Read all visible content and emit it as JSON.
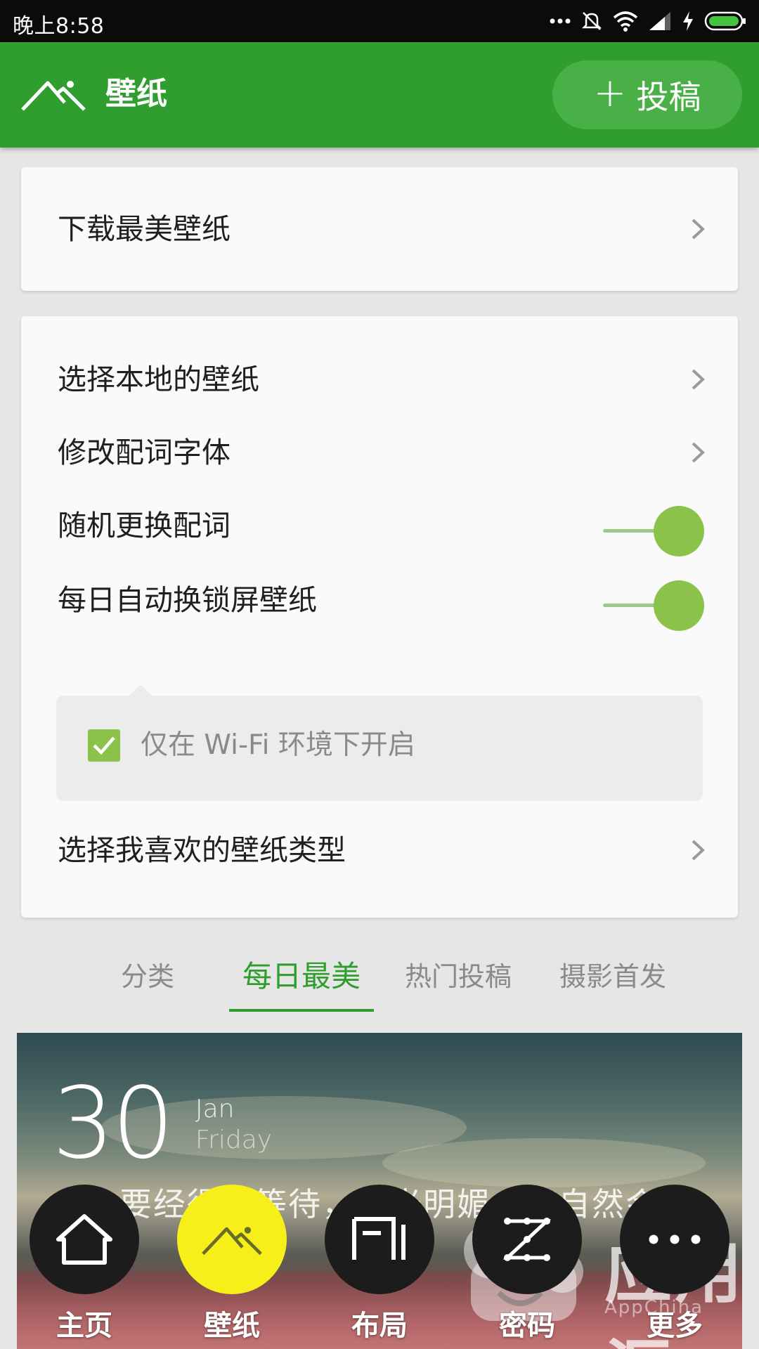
{
  "status_bar": {
    "time": "晚上8:58",
    "icons": [
      "more-dots-icon",
      "mute-vibrate-icon",
      "wifi-icon",
      "signal-icon",
      "charging-icon",
      "battery-icon"
    ]
  },
  "app_bar": {
    "title": "壁纸",
    "logo_icon": "mountain-icon",
    "submit_button": {
      "plus": "+",
      "label": "投稿"
    }
  },
  "card_1": {
    "rows": [
      {
        "label": "下载最美壁纸",
        "control": "chevron"
      }
    ]
  },
  "card_2": {
    "rows": [
      {
        "label": "选择本地的壁纸",
        "control": "chevron"
      },
      {
        "label": "修改配词字体",
        "control": "chevron"
      },
      {
        "label": "随机更换配词",
        "control": "toggle",
        "state": "on"
      },
      {
        "label": "每日自动换锁屏壁纸",
        "control": "toggle",
        "state": "on"
      },
      {
        "label": "选择我喜欢的壁纸类型",
        "control": "chevron"
      }
    ],
    "wifi_option": {
      "label": "仅在 Wi-Fi 环境下开启",
      "checked": true
    }
  },
  "tabs": [
    {
      "label": "分类",
      "active": false
    },
    {
      "label": "每日最美",
      "active": true
    },
    {
      "label": "热门投稿",
      "active": false
    },
    {
      "label": "摄影首发",
      "active": false
    }
  ],
  "preview": {
    "day": "30",
    "month": "Jan",
    "weekday": "Friday",
    "quote": "人生要经得起等待，阳光明媚，花自然会开"
  },
  "bottom_nav": [
    {
      "label": "主页",
      "icon": "home-icon",
      "active": false
    },
    {
      "label": "壁纸",
      "icon": "mountain-icon",
      "active": true
    },
    {
      "label": "布局",
      "icon": "layout-icon",
      "active": false
    },
    {
      "label": "密码",
      "icon": "pattern-lock-icon",
      "active": false
    },
    {
      "label": "更多",
      "icon": "more-icon",
      "active": false
    }
  ],
  "watermark": {
    "text": "应用汇",
    "sub": "AppChina"
  },
  "colors": {
    "primary": "#2f9e2e",
    "toggle_on": "#8bc34a",
    "active_nav": "#f6ef1a"
  }
}
